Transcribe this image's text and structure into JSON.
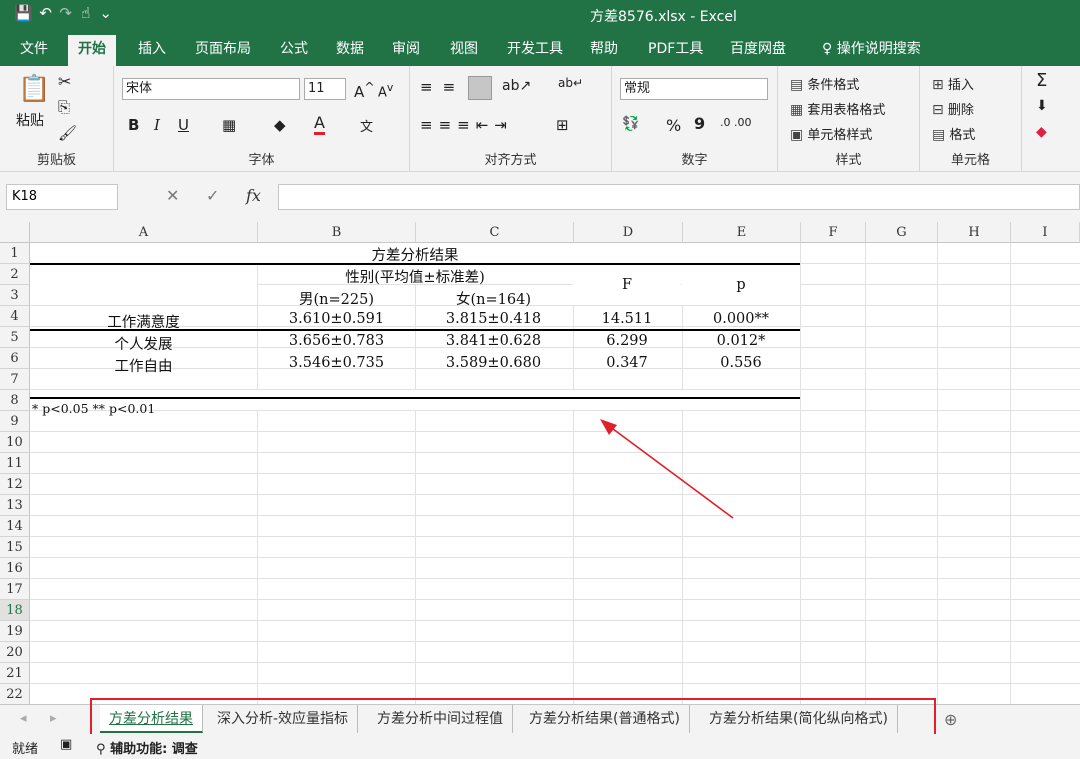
{
  "window": {
    "title": "方差8576.xlsx  -  Excel"
  },
  "qat": {
    "save": "💾",
    "undo": "↶",
    "redo": "↷",
    "touch": "☝",
    "more": "⌄"
  },
  "tabs": [
    "文件",
    "开始",
    "插入",
    "页面布局",
    "公式",
    "数据",
    "审阅",
    "视图",
    "开发工具",
    "帮助",
    "PDF工具",
    "百度网盘",
    "操作说明搜索"
  ],
  "ribbon": {
    "clipboard": {
      "paste": "粘贴",
      "label": "剪贴板"
    },
    "font": {
      "name": "宋体",
      "size": "11",
      "bold": "B",
      "italic": "I",
      "underline": "U",
      "label": "字体"
    },
    "alignment": {
      "label": "对齐方式"
    },
    "number": {
      "format": "常规",
      "percent": "%",
      "comma": "9",
      "label": "数字"
    },
    "styles": {
      "cond": "条件格式",
      "table": "套用表格格式",
      "cell": "单元格样式",
      "label": "样式"
    },
    "cells": {
      "insert": "插入",
      "delete": "删除",
      "format": "格式",
      "label": "单元格"
    }
  },
  "formula": {
    "cellref": "K18",
    "fx": "fx",
    "cancel": "✕",
    "enter": "✓"
  },
  "columns": [
    "A",
    "B",
    "C",
    "D",
    "E",
    "F",
    "G",
    "H",
    "I"
  ],
  "rows": [
    "1",
    "2",
    "3",
    "4",
    "5",
    "6",
    "7",
    "8",
    "9",
    "10",
    "11",
    "12",
    "13",
    "14",
    "15",
    "16",
    "17",
    "18",
    "19",
    "20",
    "21",
    "22"
  ],
  "selected_row": "18",
  "table": {
    "title": "方差分析结果",
    "header_group": "性别(平均值±标准差)",
    "male": "男(n=225)",
    "female": "女(n=164)",
    "f_header": "F",
    "p_header": "p",
    "rows": [
      {
        "label": "工作满意度",
        "male": "3.610±0.591",
        "female": "3.815±0.418",
        "f": "14.511",
        "p": "0.000**"
      },
      {
        "label": "个人发展",
        "male": "3.656±0.783",
        "female": "3.841±0.628",
        "f": "6.299",
        "p": "0.012*"
      },
      {
        "label": "工作自由",
        "male": "3.546±0.735",
        "female": "3.589±0.680",
        "f": "0.347",
        "p": "0.556"
      }
    ],
    "note": "* p<0.05 ** p<0.01"
  },
  "sheet_tabs": [
    "方差分析结果",
    "深入分析-效应量指标",
    "方差分析中间过程值",
    "方差分析结果(普通格式)",
    "方差分析结果(简化纵向格式)"
  ],
  "status": {
    "ready": "就绪",
    "accessibility": "辅助功能: 调查"
  },
  "colors": {
    "excel_green": "#217346",
    "annotation_red": "#e0202a"
  }
}
